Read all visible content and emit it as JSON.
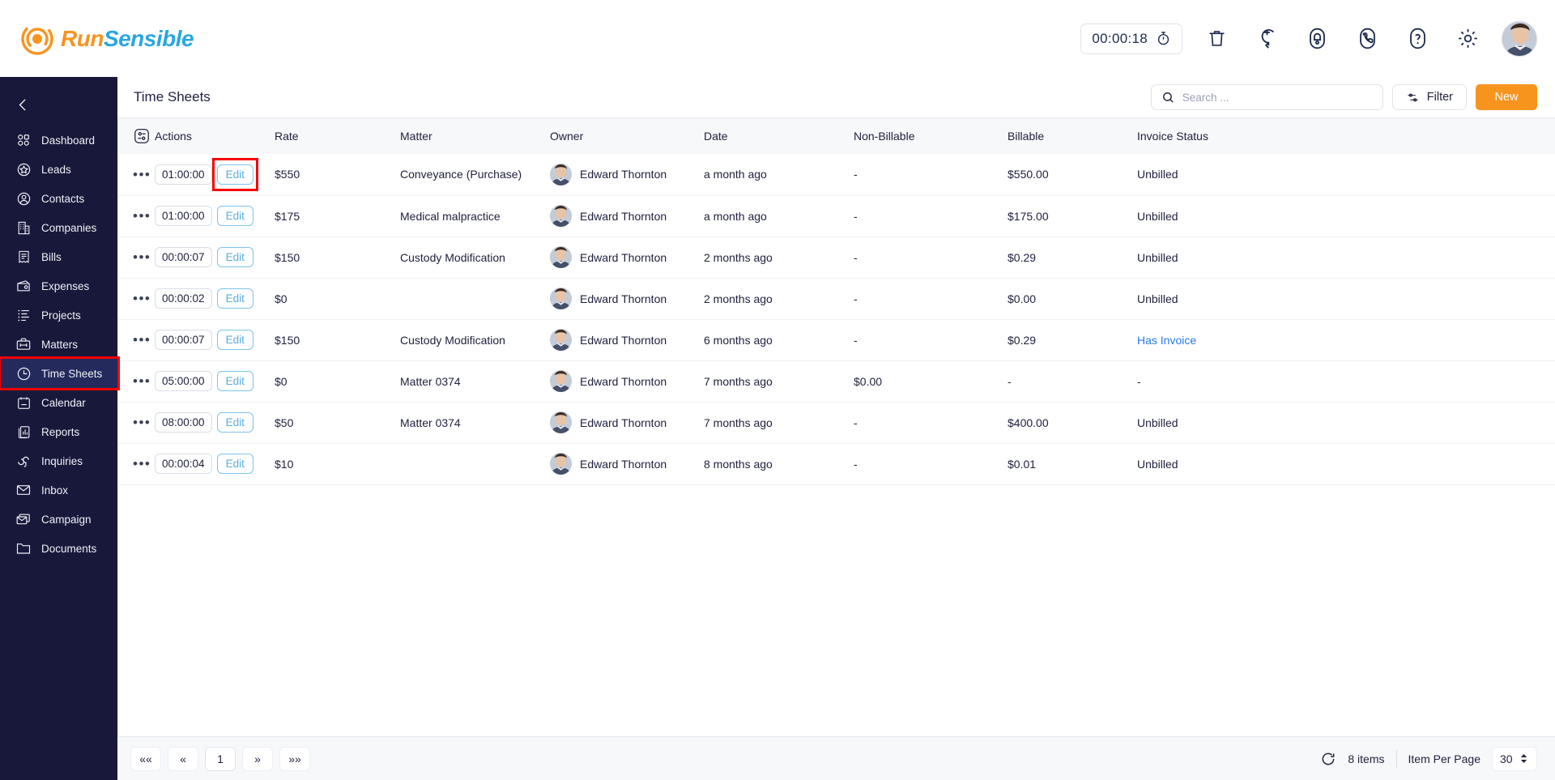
{
  "brand": {
    "run": "Run",
    "sensible": "Sensible"
  },
  "topbar": {
    "timer_value": "00:00:18",
    "icons": [
      "stopwatch-icon",
      "trash-icon",
      "add-circle-icon",
      "bell-icon",
      "phone-icon",
      "help-icon",
      "gear-icon",
      "user-avatar"
    ]
  },
  "sidebar": {
    "collapse_label": "collapse-sidebar",
    "active_item": "Time Sheets",
    "items": [
      {
        "label": "Dashboard",
        "icon": "dashboard-grid-icon"
      },
      {
        "label": "Leads",
        "icon": "star-badge-icon"
      },
      {
        "label": "Contacts",
        "icon": "user-circle-icon"
      },
      {
        "label": "Companies",
        "icon": "building-icon"
      },
      {
        "label": "Bills",
        "icon": "receipt-icon"
      },
      {
        "label": "Expenses",
        "icon": "wallet-icon"
      },
      {
        "label": "Projects",
        "icon": "list-icon"
      },
      {
        "label": "Matters",
        "icon": "briefcase-icon"
      },
      {
        "label": "Time Sheets",
        "icon": "clock-icon"
      },
      {
        "label": "Calendar",
        "icon": "calendar-icon"
      },
      {
        "label": "Reports",
        "icon": "report-chart-icon"
      },
      {
        "label": "Inquiries",
        "icon": "headset-icon"
      },
      {
        "label": "Inbox",
        "icon": "envelope-icon"
      },
      {
        "label": "Campaign",
        "icon": "envelopes-stack-icon"
      },
      {
        "label": "Documents",
        "icon": "folder-icon"
      }
    ]
  },
  "page": {
    "title": "Time Sheets",
    "search_placeholder": "Search ...",
    "search_value": "",
    "filter_label": "Filter",
    "new_label": "New"
  },
  "table": {
    "columns": [
      "Actions",
      "Rate",
      "Matter",
      "Owner",
      "Date",
      "Non-Billable",
      "Billable",
      "Invoice Status"
    ],
    "edit_label": "Edit",
    "rows": [
      {
        "time": "01:00:00",
        "rate": "$550",
        "matter": "Conveyance (Purchase)",
        "owner": "Edward Thornton",
        "date": "a month ago",
        "non_billable": "-",
        "billable": "$550.00",
        "invoice_status": "Unbilled",
        "invoice_link": false
      },
      {
        "time": "01:00:00",
        "rate": "$175",
        "matter": "Medical malpractice",
        "owner": "Edward Thornton",
        "date": "a month ago",
        "non_billable": "-",
        "billable": "$175.00",
        "invoice_status": "Unbilled",
        "invoice_link": false
      },
      {
        "time": "00:00:07",
        "rate": "$150",
        "matter": "Custody Modification",
        "owner": "Edward Thornton",
        "date": "2 months ago",
        "non_billable": "-",
        "billable": "$0.29",
        "invoice_status": "Unbilled",
        "invoice_link": false
      },
      {
        "time": "00:00:02",
        "rate": "$0",
        "matter": "",
        "owner": "Edward Thornton",
        "date": "2 months ago",
        "non_billable": "-",
        "billable": "$0.00",
        "invoice_status": "Unbilled",
        "invoice_link": false
      },
      {
        "time": "00:00:07",
        "rate": "$150",
        "matter": "Custody Modification",
        "owner": "Edward Thornton",
        "date": "6 months ago",
        "non_billable": "-",
        "billable": "$0.29",
        "invoice_status": "Has Invoice",
        "invoice_link": true
      },
      {
        "time": "05:00:00",
        "rate": "$0",
        "matter": "Matter 0374",
        "owner": "Edward Thornton",
        "date": "7 months ago",
        "non_billable": "$0.00",
        "billable": "-",
        "invoice_status": "-",
        "invoice_link": false
      },
      {
        "time": "08:00:00",
        "rate": "$50",
        "matter": "Matter 0374",
        "owner": "Edward Thornton",
        "date": "7 months ago",
        "non_billable": "-",
        "billable": "$400.00",
        "invoice_status": "Unbilled",
        "invoice_link": false
      },
      {
        "time": "00:00:04",
        "rate": "$10",
        "matter": "",
        "owner": "Edward Thornton",
        "date": "8 months ago",
        "non_billable": "-",
        "billable": "$0.01",
        "invoice_status": "Unbilled",
        "invoice_link": false
      }
    ]
  },
  "footer": {
    "pagination": [
      "««",
      "«",
      "1",
      "»",
      "»»"
    ],
    "current_page": "1",
    "items_count": "8 items",
    "per_page_label": "Item Per Page",
    "per_page_value": "30"
  },
  "colors": {
    "brand_orange": "#F7941E",
    "brand_blue": "#2BA6E0",
    "sidebar_bg": "#18193a",
    "sidebar_active": "#242a5c",
    "annotation_red": "#f80000",
    "link_blue": "#2979e8",
    "edit_blue": "#5aaede"
  }
}
